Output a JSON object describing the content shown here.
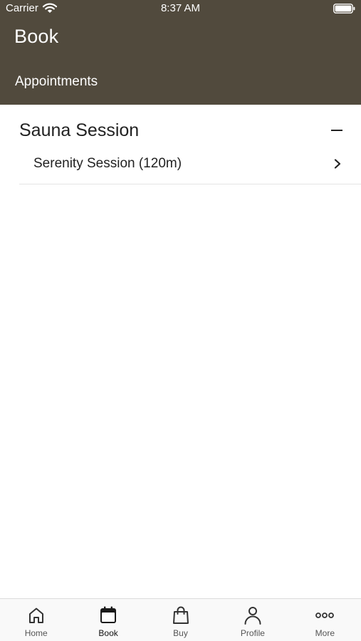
{
  "status_bar": {
    "carrier": "Carrier",
    "time": "8:37 AM"
  },
  "header": {
    "title": "Book",
    "tab": "Appointments",
    "background_color": "#514a3d"
  },
  "section": {
    "title": "Sauna Session",
    "items": [
      {
        "label": "Serenity Session (120m)"
      }
    ]
  },
  "tab_bar": {
    "active": "Book",
    "items": [
      {
        "label": "Home",
        "icon": "home-icon"
      },
      {
        "label": "Book",
        "icon": "calendar-icon"
      },
      {
        "label": "Buy",
        "icon": "shopping-bag-icon"
      },
      {
        "label": "Profile",
        "icon": "person-icon"
      },
      {
        "label": "More",
        "icon": "more-dots-icon"
      }
    ]
  }
}
